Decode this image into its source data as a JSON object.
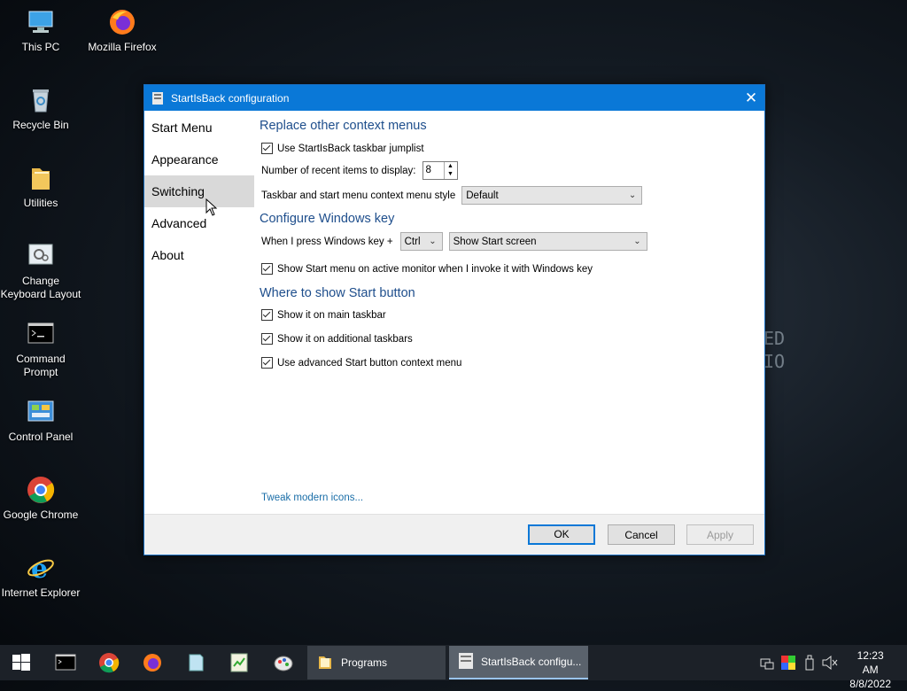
{
  "desktop": {
    "icons": [
      {
        "label": "This PC"
      },
      {
        "label": "Mozilla Firefox"
      },
      {
        "label": "Recycle Bin"
      },
      {
        "label": "Utilities"
      },
      {
        "label": "Change Keyboard Layout"
      },
      {
        "label": "Command Prompt"
      },
      {
        "label": "Control Panel"
      },
      {
        "label": "Google Chrome"
      },
      {
        "label": "Internet Explorer"
      }
    ]
  },
  "window": {
    "title": "StartIsBack configuration",
    "close_icon": "✕",
    "nav": [
      {
        "label": "Start Menu"
      },
      {
        "label": "Appearance"
      },
      {
        "label": "Switching",
        "selected": true
      },
      {
        "label": "Advanced"
      },
      {
        "label": "About"
      }
    ],
    "sections": {
      "context": {
        "title": "Replace other context menus",
        "jumplist_label": "Use StartIsBack taskbar jumplist",
        "jumplist_checked": true,
        "recent_label": "Number of recent items to display:",
        "recent_value": "8",
        "style_label": "Taskbar and start menu context menu style",
        "style_value": "Default"
      },
      "winkey": {
        "title": "Configure Windows key",
        "press_label": "When I press Windows key +",
        "modifier_value": "Ctrl",
        "action_value": "Show Start screen",
        "active_monitor_label": "Show Start menu on active monitor when I invoke it with Windows key",
        "active_monitor_checked": true
      },
      "startbutton": {
        "title": "Where to show Start button",
        "main_label": "Show it on main taskbar",
        "main_checked": true,
        "additional_label": "Show it on additional taskbars",
        "additional_checked": true,
        "advanced_label": "Use advanced Start button context menu",
        "advanced_checked": true
      }
    },
    "tweak_link": "Tweak modern icons...",
    "buttons": {
      "ok": "OK",
      "cancel": "Cancel",
      "apply": "Apply"
    }
  },
  "taskbar": {
    "buttons": [
      {
        "label": "Programs"
      },
      {
        "label": "StartIsBack configu...",
        "active": true
      }
    ],
    "clock_time": "12:23 AM",
    "clock_date": "8/8/2022"
  },
  "colors": {
    "titlebar": "#0a78d7",
    "section_title": "#1e4e8c",
    "link": "#1a6ea8",
    "taskbar": "#1c2128"
  }
}
